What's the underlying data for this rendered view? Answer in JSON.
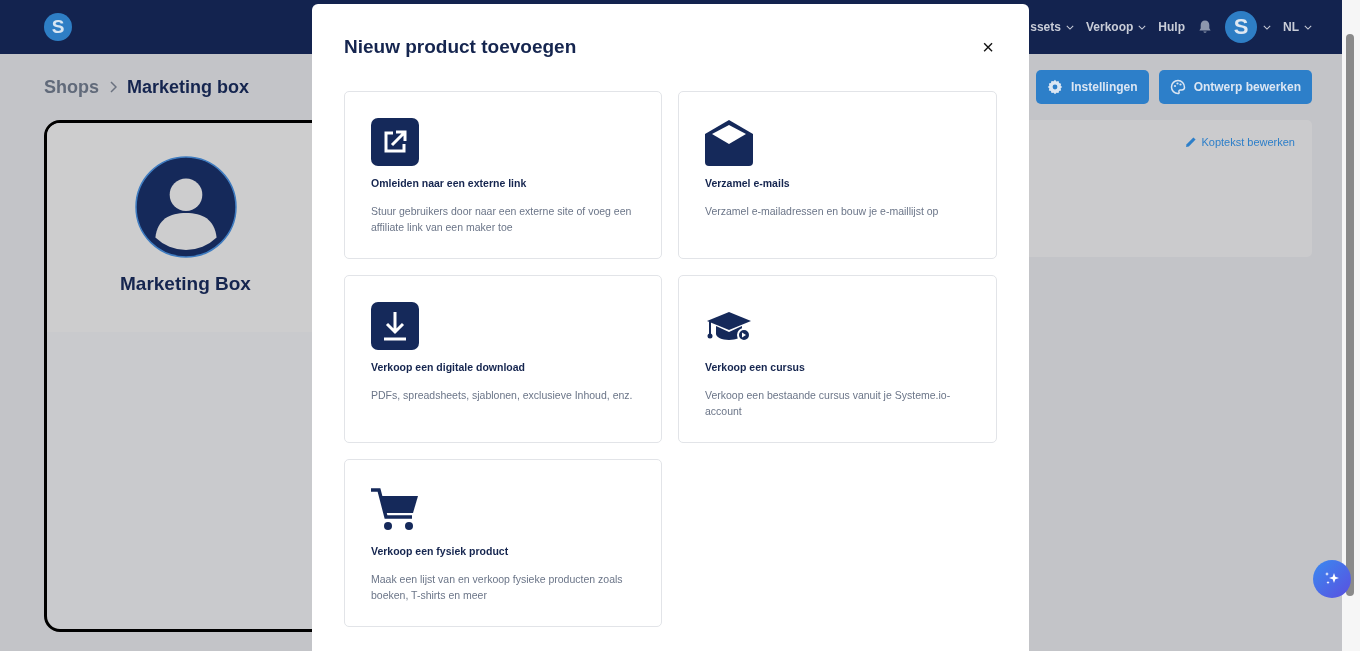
{
  "header": {
    "logo_letter": "S",
    "nav": [
      {
        "label": "ssets",
        "caret": true
      },
      {
        "label": "Verkoop",
        "caret": true
      },
      {
        "label": "Hulp",
        "caret": false
      }
    ],
    "avatar_letter": "S",
    "language": "NL"
  },
  "breadcrumb": [
    "Shops",
    "Marketing box"
  ],
  "actions": [
    {
      "kind": "settings",
      "label": "Instellingen"
    },
    {
      "kind": "design",
      "label": "Ontwerp bewerken"
    }
  ],
  "profile": {
    "name": "Marketing Box"
  },
  "header_card": {
    "link": "Koptekst bewerken"
  },
  "modal": {
    "title": "Nieuw product toevoegen",
    "close": "×",
    "options": [
      {
        "kind": "link",
        "title": "Omleiden naar een externe link",
        "description": "Stuur gebruikers door naar een externe site of voeg een affiliate link van een maker toe"
      },
      {
        "kind": "email",
        "title": "Verzamel e-mails",
        "description": "Verzamel e-mailadressen en bouw je e-maillijst op"
      },
      {
        "kind": "download",
        "title": "Verkoop een digitale download",
        "description": "PDFs, spreadsheets, sjablonen, exclusieve Inhoud, enz."
      },
      {
        "kind": "course",
        "title": "Verkoop een cursus",
        "description": "Verkoop een bestaande cursus vanuit je Systeme.io-account"
      },
      {
        "kind": "product",
        "title": "Verkoop een fysiek product",
        "description": "Maak een lijst van en verkoop fysieke producten zoals boeken, T-shirts en meer"
      }
    ]
  }
}
